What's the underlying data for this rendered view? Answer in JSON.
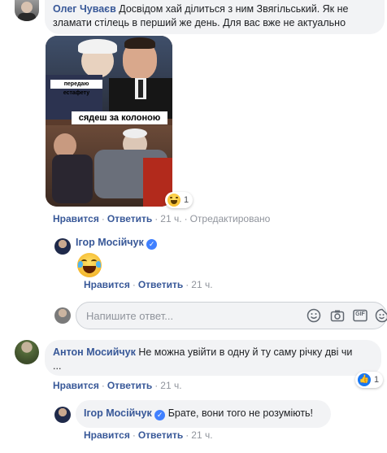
{
  "comment1": {
    "author": "Олег Чуваєв",
    "text_line1": "Досвідом хай ділиться з ним Звягільський. Як не",
    "text_line2": "зламати стілець в перший же день. Для вас вже не актуально",
    "meme": {
      "caption_top": "передаю естафету",
      "caption_bottom": "сядеш за колоною"
    },
    "reaction_count": "1",
    "actions": {
      "like": "Нравится",
      "reply": "Ответить",
      "time": "21 ч.",
      "edited": "Отредактировано"
    }
  },
  "reply1": {
    "author": "Ігор Мосійчук",
    "actions": {
      "like": "Нравится",
      "reply": "Ответить",
      "time": "21 ч."
    }
  },
  "reply_input": {
    "placeholder": "Напишите ответ...",
    "gif_label": "GIF"
  },
  "comment2": {
    "author": "Антон Мосийчук",
    "text_line1": "Не можна увійти в одну й ту саму річку дві чи",
    "text_line2": "...",
    "reaction_count": "1",
    "actions": {
      "like": "Нравится",
      "reply": "Ответить",
      "time": "21 ч."
    }
  },
  "reply2": {
    "author": "Ігор Мосійчук",
    "text": "Брате, вони того не розуміють!",
    "actions": {
      "like": "Нравится",
      "reply": "Ответить",
      "time": "21 ч."
    }
  },
  "colors": {
    "link": "#385898",
    "bubble": "#f2f3f5",
    "verified": "#4080ff",
    "like": "#1877f2"
  }
}
